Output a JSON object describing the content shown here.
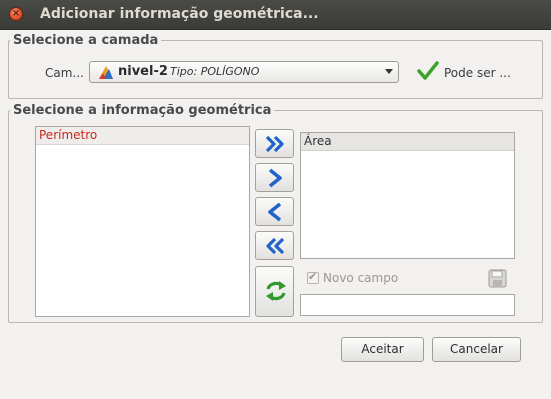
{
  "window": {
    "title": "Adicionar informação geométrica..."
  },
  "camada": {
    "legend": "Selecione a camada",
    "label": "Cam...",
    "selected_name": "nivel-2",
    "selected_type": "Tipo: POLÍGONO",
    "status": "Pode ser ..."
  },
  "info": {
    "legend": "Selecione a informação geométrica",
    "available": [
      "Perímetro"
    ],
    "selected": [
      "Área"
    ],
    "novo_campo": "Novo campo",
    "field_value": ""
  },
  "buttons": {
    "ok": "Aceitar",
    "cancel": "Cancelar"
  },
  "colors": {
    "accent_arrow": "#1f64c8",
    "refresh": "#2e9a2e",
    "check": "#3aa52a",
    "removed_item": "#c8281e"
  }
}
